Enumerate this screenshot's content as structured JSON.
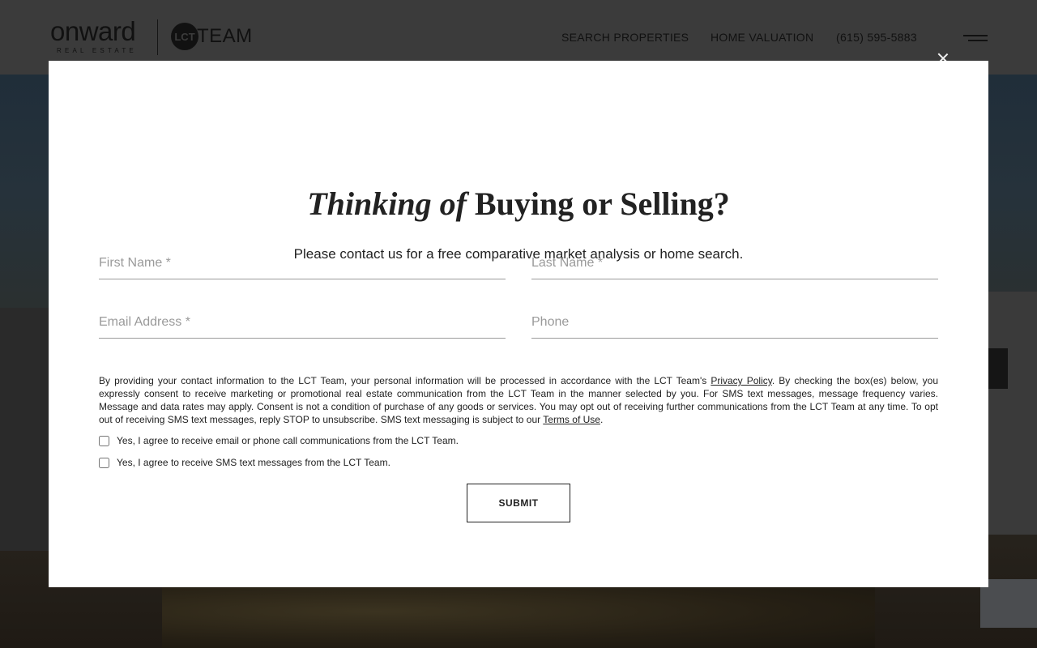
{
  "header": {
    "logo_primary": "onward",
    "logo_primary_sub": "REAL ESTATE",
    "logo_team_mark": "LCT",
    "logo_team_text": "TEAM",
    "nav": {
      "search": "SEARCH PROPERTIES",
      "valuation": "HOME VALUATION",
      "phone": "(615) 595-5883"
    },
    "menu_icon": "hamburger-menu-icon"
  },
  "modal": {
    "close_icon": "close-icon",
    "title_italic": "Thinking of",
    "title_regular": " Buying or Selling?",
    "subtitle": "Please contact us for a free comparative market analysis or home search.",
    "fields": {
      "first_name": "First Name *",
      "last_name": "Last Name *",
      "email": "Email Address *",
      "phone": "Phone"
    },
    "disclaimer": {
      "part1": "By providing your contact information to the LCT Team, your personal information will be processed in accordance with the LCT Team's ",
      "privacy_link": "Privacy Policy",
      "part2": ". By checking the box(es) below, you expressly consent to receive marketing or promotional real estate communication from the LCT Team in the manner selected by you. For SMS text messages, message frequency varies. Message and data rates may apply. Consent is not a condition of purchase of any goods or services. You may opt out of receiving further communications from the LCT Team at any time. To opt out of receiving SMS text messages, reply STOP to unsubscribe. SMS text messaging is subject to our ",
      "terms_link": "Terms of Use",
      "part3": "."
    },
    "consent_email": "Yes, I agree to receive email or phone call communications from the LCT Team.",
    "consent_sms": "Yes, I agree to receive SMS text messages from the LCT Team.",
    "submit_label": "SUBMIT"
  }
}
